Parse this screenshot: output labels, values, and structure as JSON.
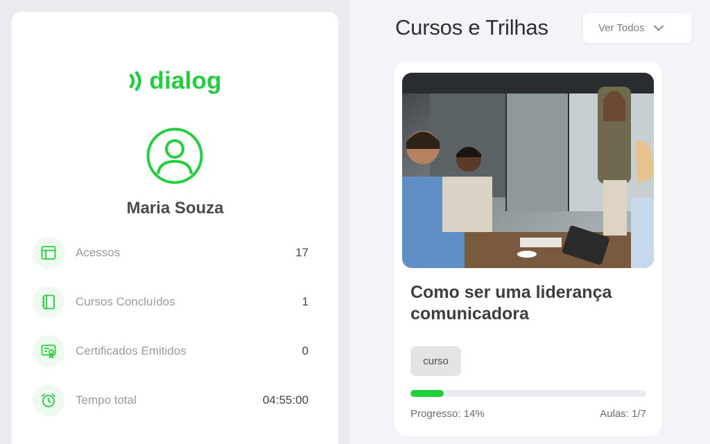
{
  "profile": {
    "logo_text": "dialog",
    "name": "Maria Souza",
    "stats": [
      {
        "label": "Acessos",
        "value": "17",
        "icon": "browser-window-icon"
      },
      {
        "label": "Cursos Concluídos",
        "value": "1",
        "icon": "notebook-icon"
      },
      {
        "label": "Certificados Emitidos",
        "value": "0",
        "icon": "certificate-icon"
      },
      {
        "label": "Tempo total",
        "value": "04:55:00",
        "icon": "alarm-clock-icon"
      }
    ]
  },
  "courses": {
    "title": "Cursos e Trilhas",
    "filter": {
      "selected": "Ver Todos"
    },
    "items": [
      {
        "title": "Como ser uma liderança comunicadora",
        "tag": "curso",
        "progress_label": "Progresso: 14%",
        "progress": 0.14,
        "lessons_label": "Aulas: 1/7",
        "image": "team-meeting-photo"
      }
    ]
  },
  "colors": {
    "brand": "#1fcf3c",
    "brand_soft": "#eefaef"
  }
}
